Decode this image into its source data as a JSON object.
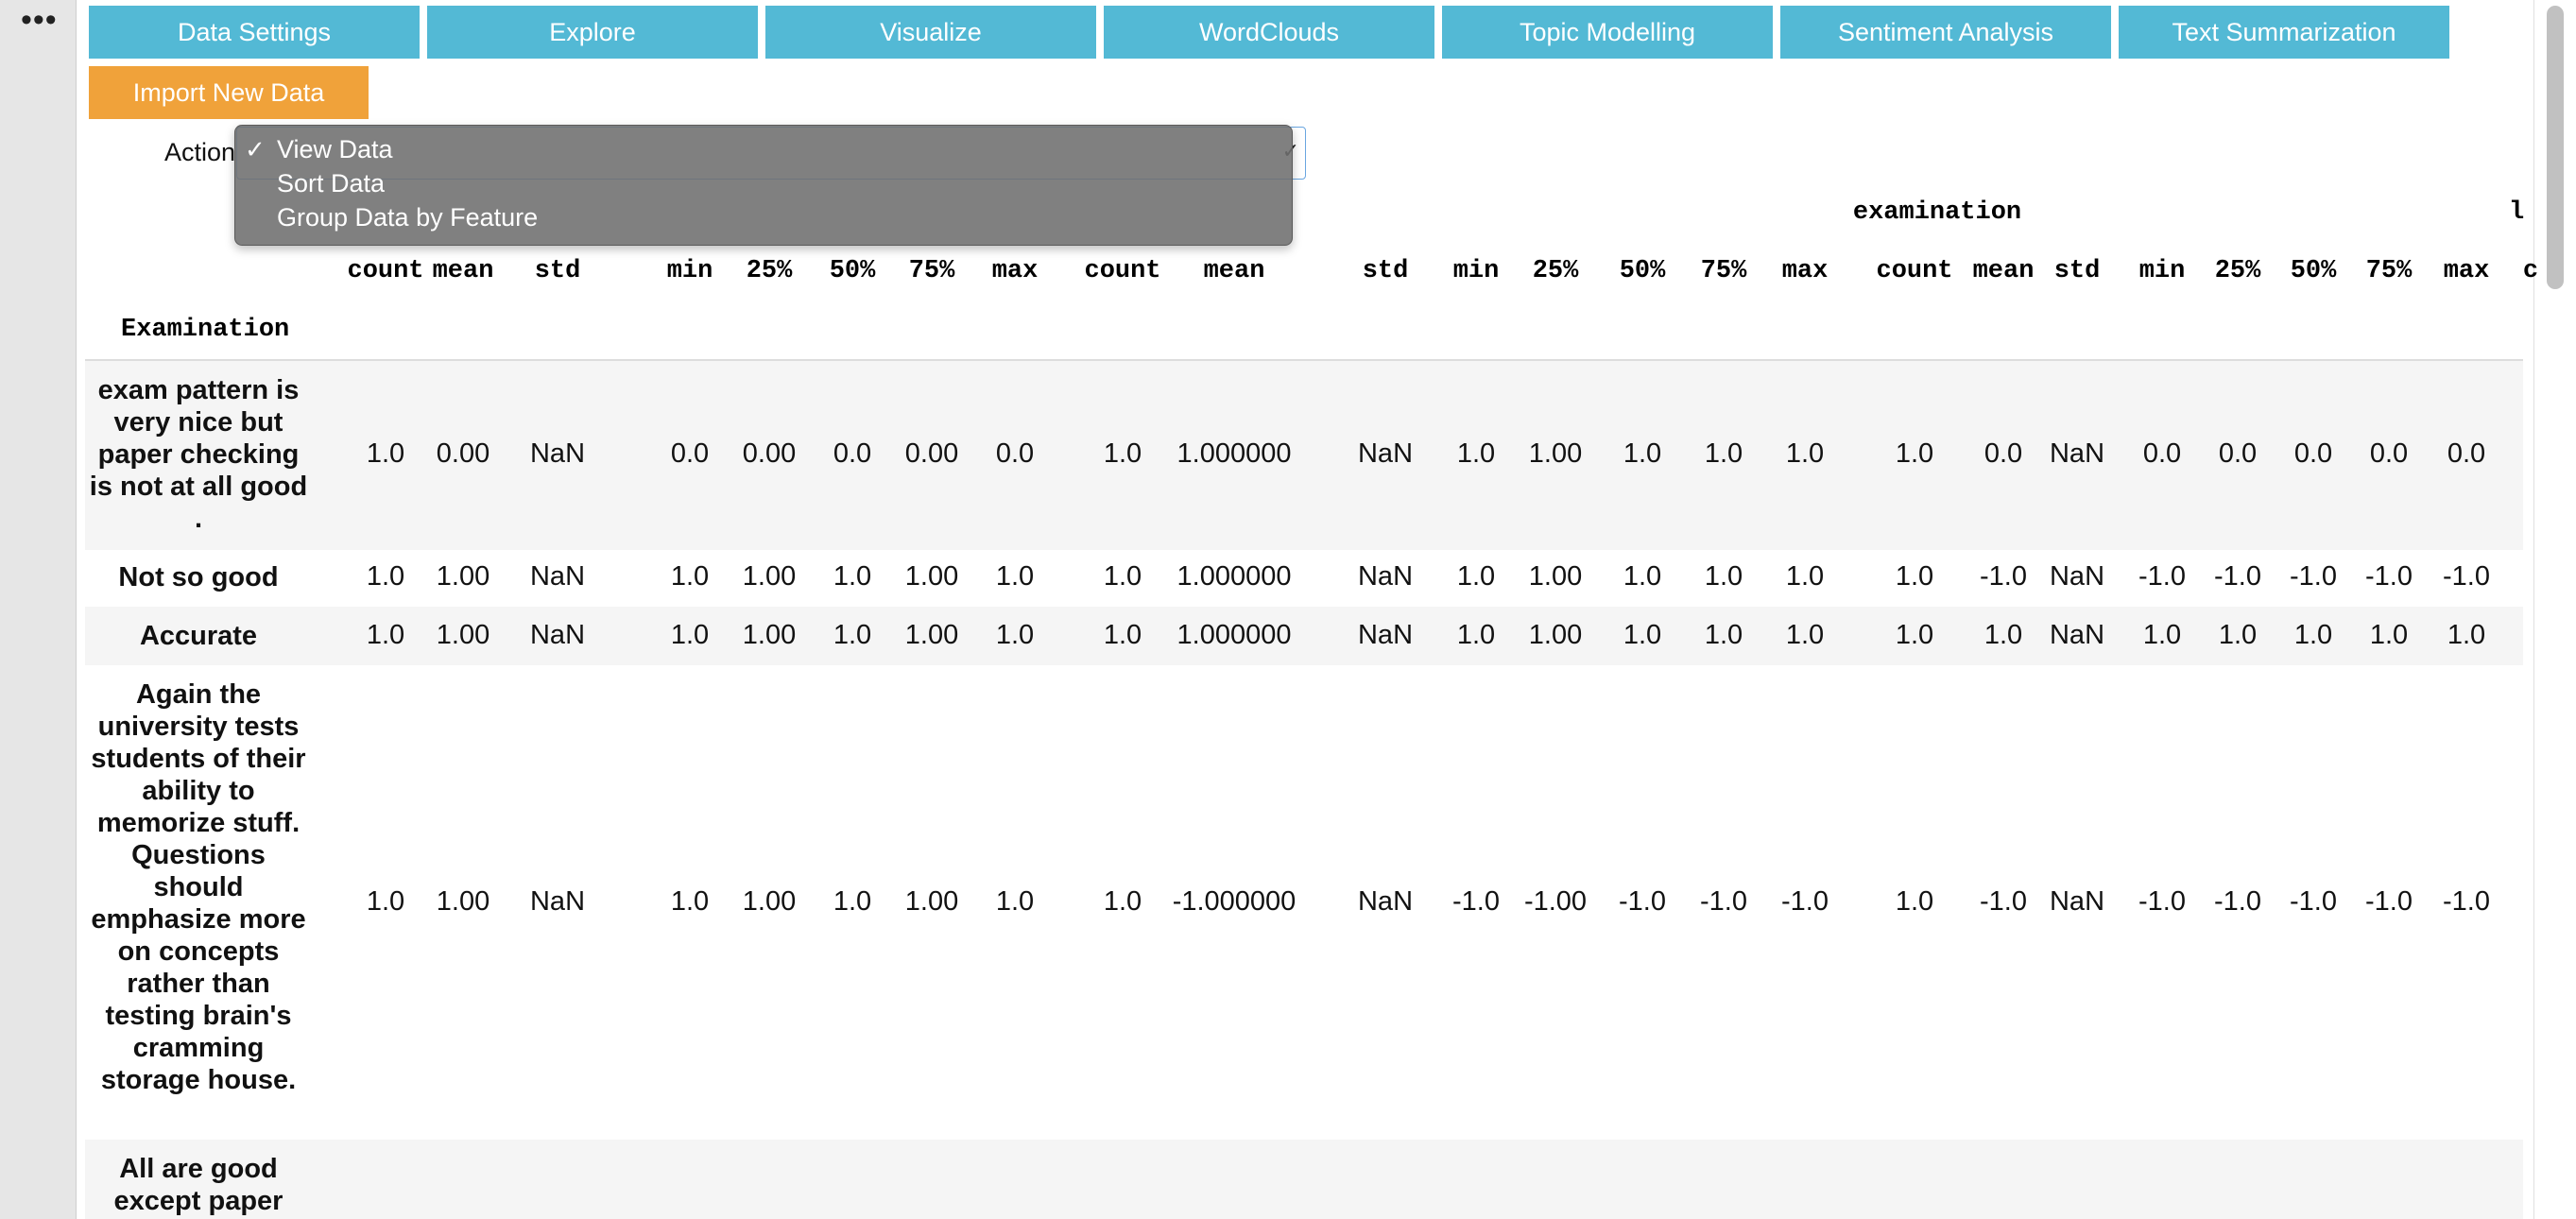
{
  "nav": {
    "tabs": [
      "Data Settings",
      "Explore",
      "Visualize",
      "WordClouds",
      "Topic Modelling",
      "Sentiment Analysis",
      "Text Summarization"
    ],
    "import_button": "Import New Data",
    "more_icon": "ellipsis-icon"
  },
  "action": {
    "label": "Action",
    "options": [
      "View Data",
      "Sort Data",
      "Group Data by Feature"
    ],
    "selected": "View Data"
  },
  "table": {
    "group_headers": [
      "examination",
      "l"
    ],
    "column_headers": [
      "count",
      "mean",
      "std",
      "min",
      "25%",
      "50%",
      "75%",
      "max",
      "count",
      "mean",
      "std",
      "min",
      "25%",
      "50%",
      "75%",
      "max",
      "count",
      "mean",
      "std",
      "min",
      "25%",
      "50%",
      "75%",
      "max",
      "c"
    ],
    "index_name": "Examination",
    "rows": [
      {
        "label": "exam pattern is very nice but paper checking is not at all good .",
        "values": [
          "1.0",
          "0.00",
          "NaN",
          "0.0",
          "0.00",
          "0.0",
          "0.00",
          "0.0",
          "1.0",
          "1.000000",
          "NaN",
          "1.0",
          "1.00",
          "1.0",
          "1.0",
          "1.0",
          "1.0",
          "0.0",
          "NaN",
          "0.0",
          "0.0",
          "0.0",
          "0.0",
          "0.0"
        ]
      },
      {
        "label": "Not so good",
        "values": [
          "1.0",
          "1.00",
          "NaN",
          "1.0",
          "1.00",
          "1.0",
          "1.00",
          "1.0",
          "1.0",
          "1.000000",
          "NaN",
          "1.0",
          "1.00",
          "1.0",
          "1.0",
          "1.0",
          "1.0",
          "-1.0",
          "NaN",
          "-1.0",
          "-1.0",
          "-1.0",
          "-1.0",
          "-1.0"
        ]
      },
      {
        "label": "Accurate",
        "values": [
          "1.0",
          "1.00",
          "NaN",
          "1.0",
          "1.00",
          "1.0",
          "1.00",
          "1.0",
          "1.0",
          "1.000000",
          "NaN",
          "1.0",
          "1.00",
          "1.0",
          "1.0",
          "1.0",
          "1.0",
          "1.0",
          "NaN",
          "1.0",
          "1.0",
          "1.0",
          "1.0",
          "1.0"
        ]
      },
      {
        "label": "Again the university tests students of their ability to memorize stuff. Questions should emphasize more on concepts rather than testing brain's cramming storage house.",
        "values": [
          "1.0",
          "1.00",
          "NaN",
          "1.0",
          "1.00",
          "1.0",
          "1.00",
          "1.0",
          "1.0",
          "-1.000000",
          "NaN",
          "-1.0",
          "-1.00",
          "-1.0",
          "-1.0",
          "-1.0",
          "1.0",
          "-1.0",
          "NaN",
          "-1.0",
          "-1.0",
          "-1.0",
          "-1.0",
          "-1.0"
        ]
      },
      {
        "label": "All are good except paper",
        "values": []
      }
    ]
  }
}
